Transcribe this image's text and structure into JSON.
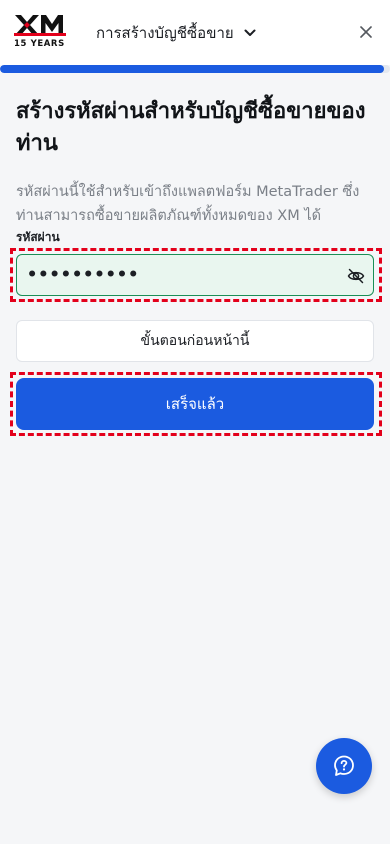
{
  "brand": {
    "logo_text": "XM",
    "years_text": "15 YEARS",
    "accent_color": "#1b5be0",
    "logo_red": "#e3001b"
  },
  "header": {
    "title": "การสร้างบัญชีซื้อขาย",
    "dropdown_icon": "chevron-down-icon",
    "close_icon": "close-icon"
  },
  "progress": {
    "fraction": 0.985
  },
  "main": {
    "title": "สร้างรหัสผ่านสำหรับบัญชีซื้อขายของท่าน",
    "description": "รหัสผ่านนี้ใช้สำหรับเข้าถึงแพลตฟอร์ม MetaTrader ซึ่งท่านสามารถซื้อขายผลิตภัณฑ์ทั้งหมดของ XM ได้",
    "password": {
      "label": "รหัสผ่าน",
      "value": "••••••••••",
      "toggle_icon": "eye-off-icon"
    },
    "previous_button": "ขั้นตอนก่อนหน้านี้",
    "done_button": "เสร็จแล้ว"
  },
  "help_button": {
    "icon": "help-chat-icon"
  }
}
